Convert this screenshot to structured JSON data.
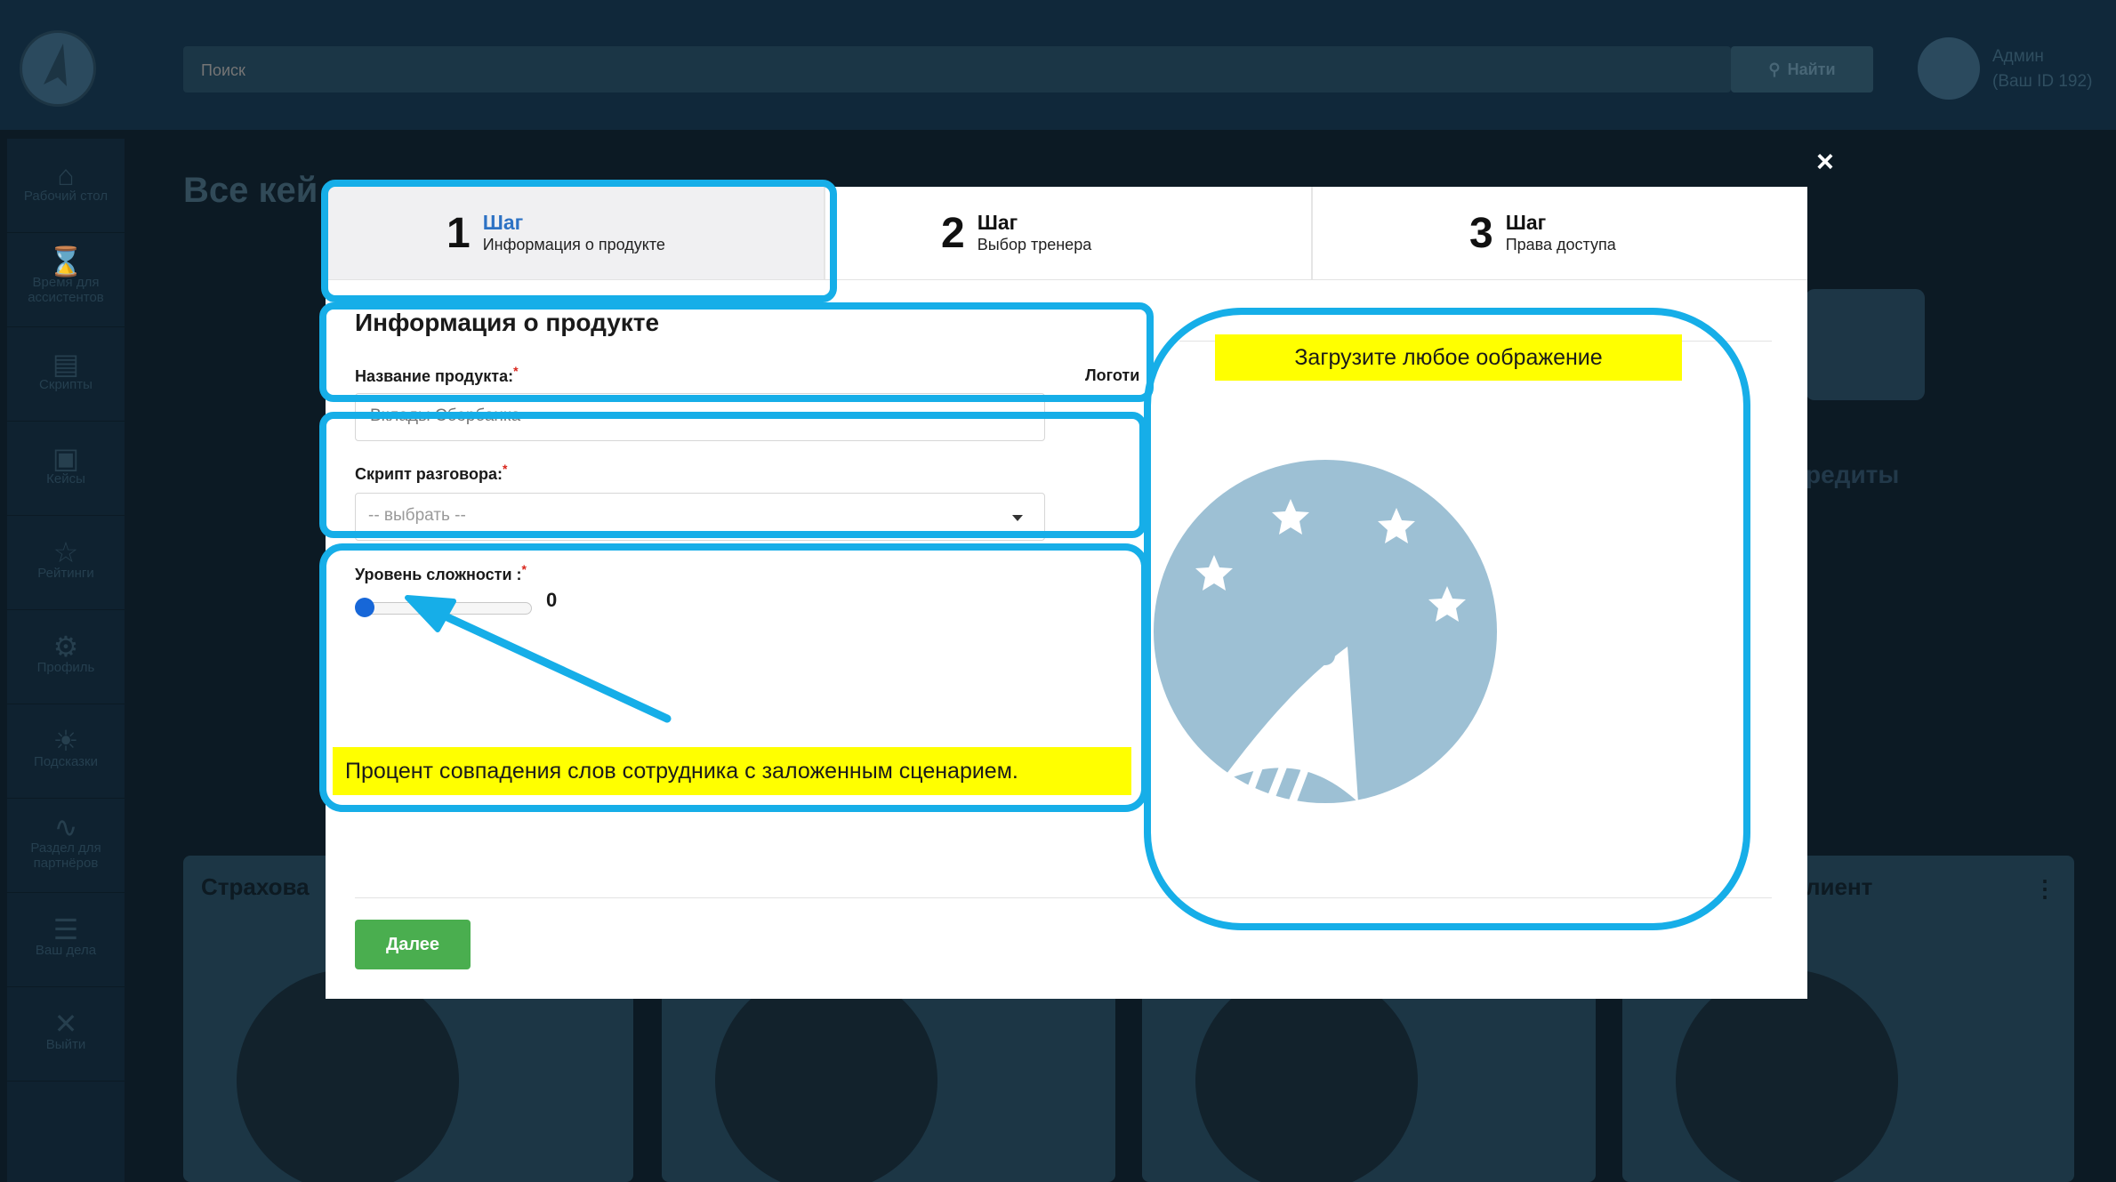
{
  "topbar": {
    "search_placeholder": "Поиск",
    "search_button": "Найти",
    "user_name": "Админ",
    "user_id": "(Ваш ID 192)"
  },
  "sidebar": {
    "items": [
      {
        "label": "Рабочий стол",
        "icon": "home-icon"
      },
      {
        "label": "Время для ассистентов",
        "icon": "hourglass-icon"
      },
      {
        "label": "Скрипты",
        "icon": "document-icon"
      },
      {
        "label": "Кейсы",
        "icon": "briefcase-icon"
      },
      {
        "label": "Рейтинги",
        "icon": "trophy-icon"
      },
      {
        "label": "Профиль",
        "icon": "gear-icon"
      },
      {
        "label": "Подсказки",
        "icon": "bulb-icon"
      },
      {
        "label": "Раздел для партнёров",
        "icon": "chart-icon"
      },
      {
        "label": "Ваш дела",
        "icon": "list-icon"
      },
      {
        "label": "Выйти",
        "icon": "close-icon"
      }
    ]
  },
  "background": {
    "heading": "Все кей",
    "credit_text": "редиты",
    "card_left_title": "Страхова",
    "card_right_title": "лиент"
  },
  "modal": {
    "close": "×",
    "steps": [
      {
        "num": "1",
        "title": "Шаг",
        "subtitle": "Информация о продукте"
      },
      {
        "num": "2",
        "title": "Шаг",
        "subtitle": "Выбор тренера"
      },
      {
        "num": "3",
        "title": "Шаг",
        "subtitle": "Права доступа"
      }
    ],
    "section_title": "Информация о продукте",
    "product_name_label": "Название продукта:",
    "product_name_value": "Вклады Сбербанка",
    "logo_label": "Логоти",
    "script_label": "Скрипт разговора:",
    "script_value": "-- выбрать --",
    "difficulty_label": "Уровень сложности :",
    "difficulty_value": "0",
    "required_mark": "*",
    "next_button": "Далее"
  },
  "annotations": {
    "upload_hint": "Загрузите любое оображение",
    "slider_hint": "Процент совпадения слов сотрудника с заложенным сценарием."
  },
  "colors": {
    "highlight": "#16aee8",
    "note": "#ffff00",
    "primary_button": "#4aae4f",
    "active_step": "#2d72c4"
  }
}
